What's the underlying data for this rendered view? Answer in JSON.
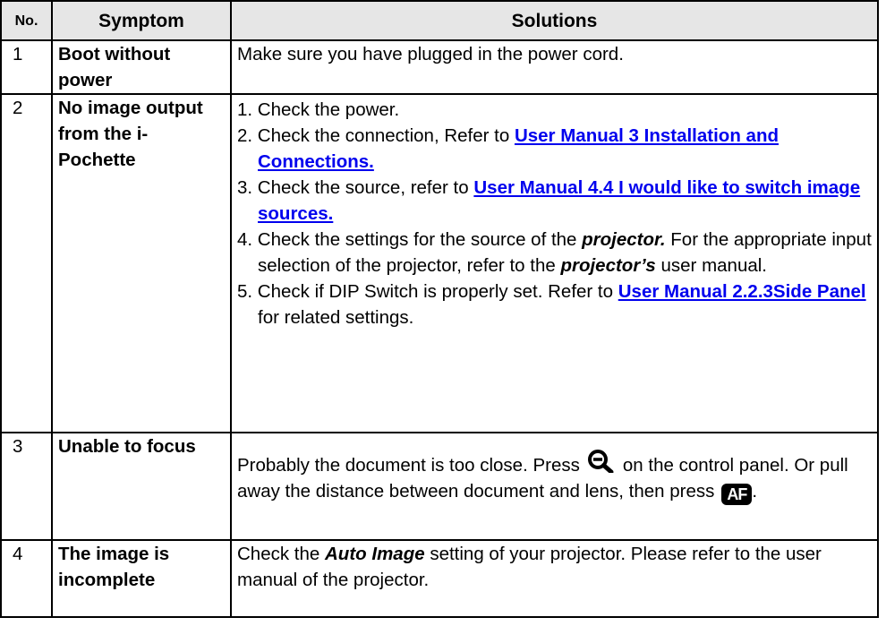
{
  "table": {
    "headers": {
      "no": "No.",
      "symptom": "Symptom",
      "solutions": "Solutions"
    },
    "rows": [
      {
        "no": "1",
        "symptom": "Boot without power",
        "solution": "Make sure you have plugged in the power cord."
      },
      {
        "no": "2",
        "symptom": "No image output from the i-Pochette",
        "steps": {
          "s1": "1. Check the power.",
          "s2_pre": "2. Check the connection, Refer to ",
          "s2_link": "User Manual 3 Installation and Connections.",
          "s3_pre": "3. Check the source, refer to ",
          "s3_link": "User Manual 4.4 I would like to switch image sources.",
          "s4_a": "4. Check the settings for the source of the ",
          "s4_em1": "projector.",
          "s4_b": " For the appropriate input selection of the projector, refer to the ",
          "s4_em2": "projector’s",
          "s4_c": " user manual.",
          "s5_pre": "5. Check if DIP Switch is properly set. Refer to ",
          "s5_link": "User Manual 2.2.3Side Panel ",
          "s5_post": " for related settings."
        }
      },
      {
        "no": "3",
        "symptom": "Unable to focus",
        "sol_a": "Probably the document is too close. Press",
        "sol_b": "on the control panel. Or pull away the distance between document and lens, then press",
        "af_label": "AF",
        "sol_end": "."
      },
      {
        "no": "4",
        "symptom": "The image is incomplete",
        "sol_a": "Check the ",
        "sol_em": "Auto Image",
        "sol_b": " setting of your projector. Please refer to the user manual of the projector."
      }
    ]
  },
  "icons": {
    "zoom": "zoom-out-magnifier-icon",
    "af": "auto-focus-icon"
  },
  "colors": {
    "link": "#0000ee",
    "header_bg": "#e6e6e6"
  }
}
